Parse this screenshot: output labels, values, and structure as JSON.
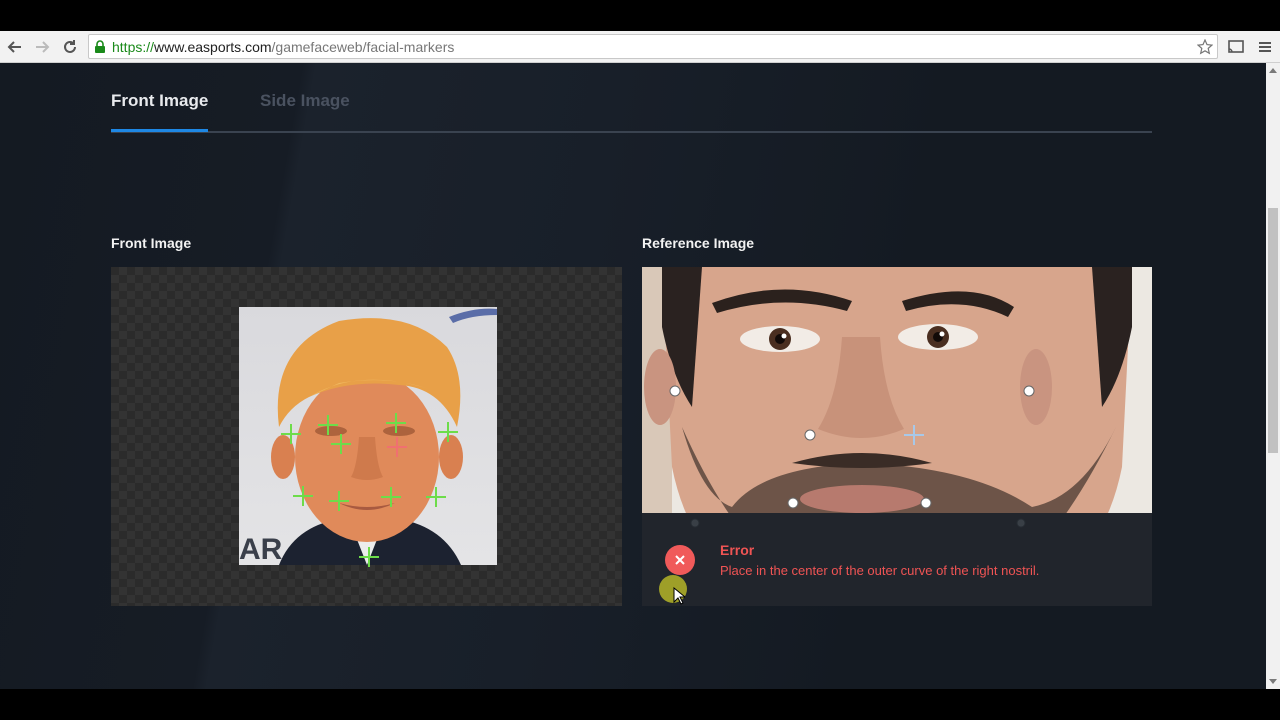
{
  "browser": {
    "url_scheme": "https://",
    "url_host": "www.easports.com",
    "url_path": "/gamefaceweb/facial-markers"
  },
  "tabs": {
    "front": "Front Image",
    "side": "Side Image",
    "active": "front"
  },
  "front_panel": {
    "label": "Front Image",
    "photo_bg_text": "AR"
  },
  "reference_panel": {
    "label": "Reference Image"
  },
  "error": {
    "title": "Error",
    "message": "Place in the center of the outer curve of the right nostril."
  },
  "colors": {
    "accent": "#1e88e5",
    "error": "#ef5454",
    "marker_ok": "#6ddc4a",
    "marker_active": "#f07070",
    "page_bg": "#141a22"
  }
}
